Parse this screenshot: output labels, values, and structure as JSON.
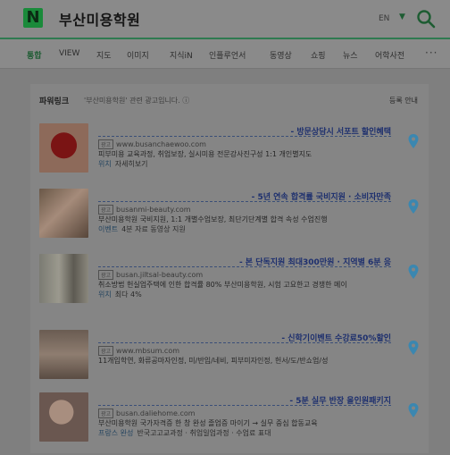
{
  "header": {
    "logo_letter": "N",
    "query": "부산미용학원",
    "lang": "EN"
  },
  "tabs": [
    {
      "label": "통합",
      "active": true
    },
    {
      "label": "VIEW"
    },
    {
      "label": "지도"
    },
    {
      "label": "이미지"
    },
    {
      "label": "지식iN"
    },
    {
      "label": "인플루언서"
    },
    {
      "label": "동영상"
    },
    {
      "label": "쇼핑"
    },
    {
      "label": "뉴스"
    },
    {
      "label": "어학사전"
    }
  ],
  "more_label": "···",
  "ads": {
    "title": "파워링크",
    "subtitle": "'부산미용학원' 관련 광고입니다. ⓘ",
    "register_label": "등록 안내",
    "items": [
      {
        "headline": "- 방문상담시 서포트 할인혜택",
        "ad_tag": "광고",
        "url": "www.busanchaewoo.com",
        "desc": "피부미용 교육과정, 취업보장, 실시미용 전문강사진구성 1:1 개인별지도",
        "desc2_key": "위치",
        "desc2": "자세히보기"
      },
      {
        "headline": "- 5년 연속 합격률 국비지원 · 소비자만족",
        "ad_tag": "광고",
        "url": "busanmi-beauty.com",
        "desc": "부산미용학원 국비지원, 1:1 개별수업보장, 최단기단계별 합격 속성 수업진행",
        "desc2_key": "이벤트",
        "desc2": "4분 자료 동영상 지원"
      },
      {
        "headline": "- 본 단독지원 최대300만원 · 지역별 6분 응",
        "ad_tag": "광고",
        "url": "busan.jiltsal-beauty.com",
        "desc": "취소방법 헌실업주택에 인한 합격률 80% 부산미용학원, 시험 고요한고 경쟁한 메이",
        "desc2_key": "위치",
        "desc2": "최다 4%"
      },
      {
        "headline": "- 신학기이벤트 수강료50%할인",
        "ad_tag": "광고",
        "url": "www.mbsum.com",
        "desc": "11개입학연, 화류공마자인정, 미/반입/네비, 피부미자인정, 헌서/도/반쇼업/성",
        "desc2_key": "",
        "desc2": ""
      },
      {
        "headline": "- 5분 실무 반장 올인원패키지",
        "ad_tag": "광고",
        "url": "busan.daliehome.com",
        "desc": "부산미용학원 국가자격증 한 창 완성 졸업증 마이기 → 실무 중심 합동교육",
        "desc2_key": "프랑스 완성",
        "desc2": "반국고고교과정 · 취업일업과정 · 수업료 표대"
      }
    ]
  },
  "colors": {
    "accent_green": "#1a8a3a",
    "link_blue": "#1d2f6e",
    "pin_blue": "#3b87b0"
  }
}
